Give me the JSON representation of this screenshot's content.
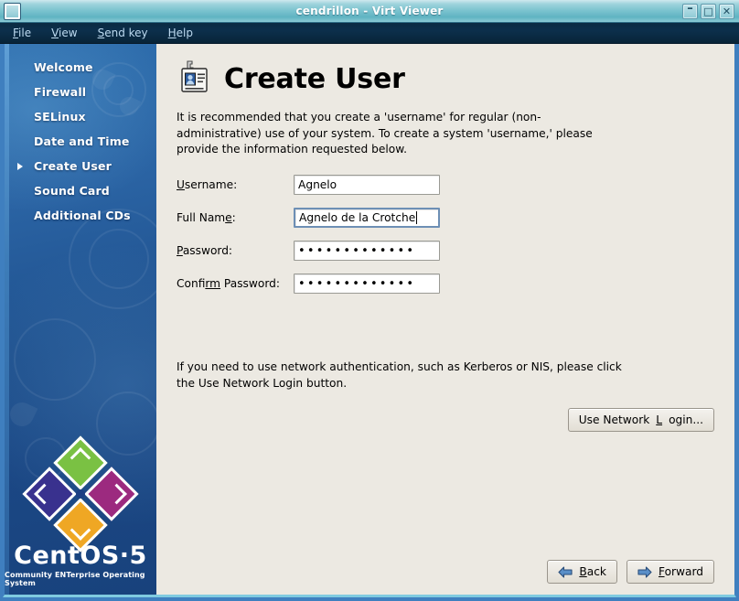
{
  "window": {
    "title": "cendrillon - Virt Viewer",
    "app_icon": "window-icon",
    "controls": {
      "minimize": "–",
      "maximize": "□",
      "close": "✕"
    }
  },
  "menubar": {
    "items": [
      {
        "label": "File",
        "mnemonic": "F"
      },
      {
        "label": "View",
        "mnemonic": "V"
      },
      {
        "label": "Send key",
        "mnemonic": "S"
      },
      {
        "label": "Help",
        "mnemonic": "H"
      }
    ]
  },
  "sidebar": {
    "items": [
      {
        "label": "Welcome",
        "active": false
      },
      {
        "label": "Firewall",
        "active": false
      },
      {
        "label": "SELinux",
        "active": false
      },
      {
        "label": "Date and Time",
        "active": false
      },
      {
        "label": "Create User",
        "active": true
      },
      {
        "label": "Sound Card",
        "active": false
      },
      {
        "label": "Additional CDs",
        "active": false
      }
    ],
    "logo": {
      "wordmark": "CentOS·5",
      "tagline": "Community ENTerprise Operating System"
    }
  },
  "main": {
    "icon": "id-badge-icon",
    "title": "Create User",
    "intro": "It is recommended that you create a 'username' for regular (non-administrative) use of your system. To create a system 'username,' please provide the information requested below.",
    "fields": [
      {
        "label_pre": "",
        "label_mn": "U",
        "label_post": "sername:",
        "value": "Agnelo",
        "type": "text",
        "focused": false
      },
      {
        "label_pre": "Full Nam",
        "label_mn": "e",
        "label_post": ":",
        "value": "Agnelo de la Crotche",
        "type": "text",
        "focused": true
      },
      {
        "label_pre": "",
        "label_mn": "P",
        "label_post": "assword:",
        "value": "•••••••••••••",
        "type": "password",
        "focused": false
      },
      {
        "label_pre": "Confi",
        "label_mn": "rm",
        "label_post": " Password:",
        "value": "•••••••••••••",
        "type": "password",
        "focused": false
      }
    ],
    "network_note": "If you need to use network authentication, such as Kerberos or NIS, please click the Use Network Login button.",
    "network_button": {
      "pre": "Use Network ",
      "mn": "L",
      "post": "ogin..."
    }
  },
  "footer": {
    "back": {
      "pre": "",
      "mn": "B",
      "post": "ack",
      "icon": "arrow-left-icon"
    },
    "forward": {
      "pre": "",
      "mn": "F",
      "post": "orward",
      "icon": "arrow-right-icon"
    }
  },
  "colors": {
    "titlebar": "#79c2ce",
    "menubar": "#0c2f4b",
    "sidebar": "#1e4f8c",
    "panel": "#ece9e2",
    "accent_border": "#3f7fbf",
    "focus_border": "#6d8fb5"
  }
}
